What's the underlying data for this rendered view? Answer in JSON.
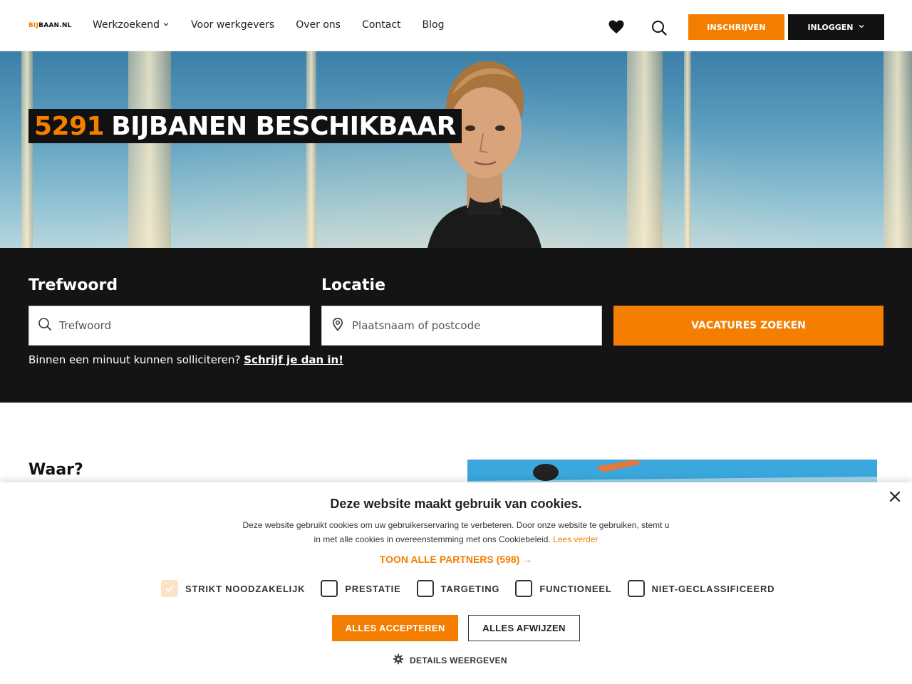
{
  "header": {
    "logo": {
      "part1": "BIJ",
      "part2": "BAAN.NL"
    },
    "nav": [
      {
        "label": "Werkzoekend",
        "has_dropdown": true
      },
      {
        "label": "Voor werkgevers"
      },
      {
        "label": "Over ons"
      },
      {
        "label": "Contact"
      },
      {
        "label": "Blog"
      }
    ],
    "icons": {
      "favorites": "heart-icon",
      "search": "search-icon"
    },
    "signup_label": "INSCHRIJVEN",
    "login_label": "INLOGGEN"
  },
  "hero": {
    "count": "5291",
    "title": "BIJBANEN BESCHIKBAAR"
  },
  "search": {
    "keyword_label": "Trefwoord",
    "keyword_placeholder": "Trefwoord",
    "location_label": "Locatie",
    "location_placeholder": "Plaatsnaam of postcode",
    "button_label": "VACATURES ZOEKEN",
    "signup_prompt": "Binnen een minuut kunnen solliciteren?",
    "signup_link": "Schrijf je dan in!"
  },
  "section": {
    "heading": "Waar?"
  },
  "cookie": {
    "title": "Deze website maakt gebruik van cookies.",
    "text": "Deze website gebruikt cookies om uw gebruikerservaring te verbeteren. Door onze website te gebruiken, stemt u in met alle cookies in overeenstemming met ons Cookiebeleid.",
    "read_more": "Lees verder",
    "partners": "TOON ALLE PARTNERS (598) →",
    "categories": [
      {
        "label": "STRIKT NOODZAKELIJK",
        "checked": true
      },
      {
        "label": "PRESTATIE",
        "checked": false
      },
      {
        "label": "TARGETING",
        "checked": false
      },
      {
        "label": "FUNCTIONEEL",
        "checked": false
      },
      {
        "label": "NIET-GECLASSIFICEERD",
        "checked": false
      }
    ],
    "accept_label": "ALLES ACCEPTEREN",
    "reject_label": "ALLES AFWIJZEN",
    "details_label": "DETAILS WEERGEVEN",
    "close_symbol": "×"
  },
  "colors": {
    "accent": "#f47e00",
    "dark": "#141414"
  }
}
